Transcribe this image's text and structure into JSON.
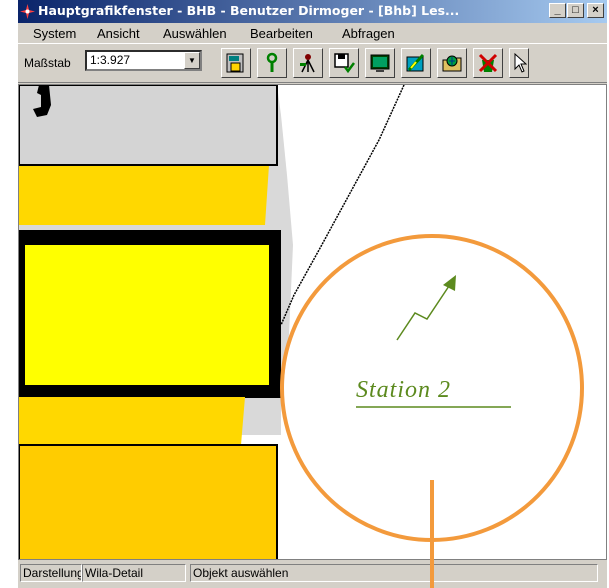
{
  "window": {
    "title": "Hauptgrafikfenster - BHB - Benutzer Dirmoger  - [Bhb] Les...",
    "controls": {
      "minimize": "_",
      "maximize": "□",
      "close": "×"
    }
  },
  "menubar": {
    "items": [
      {
        "label": "System"
      },
      {
        "label": "Ansicht"
      },
      {
        "label": "Auswählen"
      },
      {
        "label": "Bearbeiten"
      },
      {
        "label": "Abfragen"
      }
    ]
  },
  "toolbar": {
    "scale_label": "Maßstab",
    "scale_value": "1:3.927",
    "tools": [
      {
        "icon": "map-properties-icon"
      },
      {
        "icon": "wrench-icon"
      },
      {
        "icon": "survey-tripod-icon"
      },
      {
        "icon": "save-check-icon"
      },
      {
        "icon": "display-icon"
      },
      {
        "icon": "edit-map-icon"
      },
      {
        "icon": "folder-globe-icon"
      },
      {
        "icon": "delete-cross-icon"
      },
      {
        "icon": "pointer-icon"
      }
    ]
  },
  "canvas": {
    "label": "Station 2",
    "colors": {
      "label": "#5c8a1e",
      "yellow": "#f2e100",
      "yellow_dark": "#f0c800",
      "gray": "#d9d9d9"
    }
  },
  "annotation": {
    "color": "#f39a3c"
  },
  "statusbar": {
    "panel1": "Darstellung",
    "panel2": "Wila-Detail",
    "panel3": "Objekt auswählen"
  }
}
